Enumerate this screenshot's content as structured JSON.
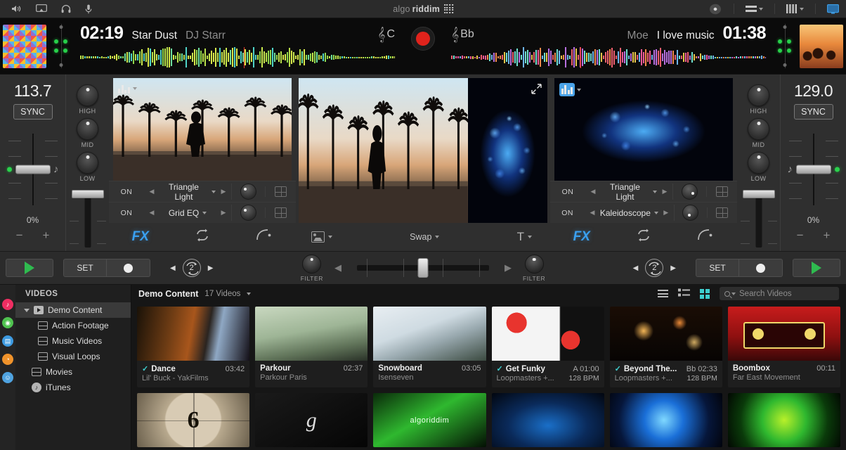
{
  "menubar": {
    "icons": [
      "speaker-icon",
      "airplay-icon",
      "headphones-icon",
      "microphone-icon"
    ],
    "brand_light": "algo",
    "brand_bold": "riddim",
    "right_icons": [
      "record-toggle-icon",
      "list-view-icon",
      "waveform-view-icon",
      "display-icon"
    ]
  },
  "deckA": {
    "time": "02:19",
    "title": "Star Dust",
    "artist": "DJ Starr",
    "key": "C",
    "bpm": "113.7",
    "sync_label": "SYNC",
    "pitch_percent": "0%",
    "eq": [
      {
        "label": "HIGH"
      },
      {
        "label": "MID"
      },
      {
        "label": "LOW"
      }
    ],
    "fx": [
      {
        "on": "ON",
        "name": "Triangle Light"
      },
      {
        "on": "ON",
        "name": "Grid EQ"
      }
    ],
    "tools": {
      "fx": "FX",
      "loop": "loop-icon",
      "bounce": "bounce-icon"
    },
    "transport": {
      "play": "play-icon",
      "set": "SET",
      "cue": "cue-icon",
      "loop_beats": "2"
    },
    "filter_label": "FILTER"
  },
  "deckB": {
    "time": "01:38",
    "title": "I love music",
    "artist": "Moe",
    "key": "Bb",
    "bpm": "129.0",
    "sync_label": "SYNC",
    "pitch_percent": "0%",
    "eq": [
      {
        "label": "HIGH"
      },
      {
        "label": "MID"
      },
      {
        "label": "LOW"
      }
    ],
    "fx": [
      {
        "on": "ON",
        "name": "Triangle Light"
      },
      {
        "on": "ON",
        "name": "Kaleidoscope"
      }
    ],
    "tools": {
      "fx": "FX",
      "loop": "loop-icon",
      "bounce": "bounce-icon"
    },
    "transport": {
      "play": "play-icon",
      "set": "SET",
      "cue": "cue-icon",
      "loop_beats": "2"
    },
    "filter_label": "FILTER"
  },
  "center": {
    "video_source_label": "video-source-icon",
    "swap_label": "Swap",
    "text_label": "text-icon"
  },
  "browser": {
    "sidebar_header": "VIDEOS",
    "items": [
      {
        "label": "Demo Content",
        "icon": "playlist-icon",
        "selected": true,
        "indent": 0,
        "disclosure": true
      },
      {
        "label": "Action Footage",
        "icon": "folder-icon",
        "selected": false,
        "indent": 1,
        "disclosure": false
      },
      {
        "label": "Music Videos",
        "icon": "folder-icon",
        "selected": false,
        "indent": 1,
        "disclosure": false
      },
      {
        "label": "Visual Loops",
        "icon": "folder-icon",
        "selected": false,
        "indent": 1,
        "disclosure": false
      },
      {
        "label": "Movies",
        "icon": "folder-icon",
        "selected": false,
        "indent": 0,
        "disclosure": false
      },
      {
        "label": "iTunes",
        "icon": "music-note-icon",
        "selected": false,
        "indent": 0,
        "disclosure": false
      }
    ],
    "breadcrumb": "Demo Content",
    "count": "17 Videos",
    "view_buttons": [
      "list-view-icon",
      "detail-view-icon",
      "grid-view-icon"
    ],
    "search_placeholder": "Search Videos",
    "grid_items": [
      {
        "title": "Dance",
        "artist": "Lil' Buck - YakFilms",
        "duration": "03:42",
        "key": "",
        "bpm": "",
        "checked": true,
        "thumb": "graffiti-wall"
      },
      {
        "title": "Parkour",
        "artist": "Parkour Paris",
        "duration": "02:37",
        "key": "",
        "bpm": "",
        "checked": false,
        "thumb": "green-hoodie"
      },
      {
        "title": "Snowboard",
        "artist": "Isenseven",
        "duration": "03:05",
        "key": "",
        "bpm": "",
        "checked": false,
        "thumb": "snow-slope"
      },
      {
        "title": "Get Funky",
        "artist": "Loopmasters +...",
        "duration": "01:00",
        "key": "A",
        "bpm": "128 BPM",
        "checked": true,
        "thumb": "red-shapes"
      },
      {
        "title": "Beyond The...",
        "artist": "Loopmasters +...",
        "duration": "02:33",
        "key": "Bb",
        "bpm": "128 BPM",
        "checked": true,
        "thumb": "orange-bokeh"
      },
      {
        "title": "Boombox",
        "artist": "Far East Movement",
        "duration": "00:11",
        "key": "",
        "bpm": "",
        "checked": false,
        "thumb": "red-boombox"
      },
      {
        "title": "",
        "artist": "",
        "duration": "",
        "key": "",
        "bpm": "",
        "checked": false,
        "thumb": "countdown-6"
      },
      {
        "title": "",
        "artist": "",
        "duration": "",
        "key": "",
        "bpm": "",
        "checked": false,
        "thumb": "g-logo"
      },
      {
        "title": "",
        "artist": "",
        "duration": "",
        "key": "",
        "bpm": "",
        "checked": false,
        "thumb": "green-algoriddim"
      },
      {
        "title": "",
        "artist": "",
        "duration": "",
        "key": "",
        "bpm": "",
        "checked": false,
        "thumb": "blue-swirl"
      },
      {
        "title": "",
        "artist": "",
        "duration": "",
        "key": "",
        "bpm": "",
        "checked": false,
        "thumb": "blue-vortex"
      },
      {
        "title": "",
        "artist": "",
        "duration": "",
        "key": "",
        "bpm": "",
        "checked": false,
        "thumb": "green-burst"
      }
    ]
  },
  "dock": [
    {
      "name": "itunes-icon",
      "color": "#ef2e62"
    },
    {
      "name": "spotify-icon",
      "color": "#4fc24f"
    },
    {
      "name": "video-library-icon",
      "color": "#3d9ae0"
    },
    {
      "name": "history-icon",
      "color": "#f0932b"
    },
    {
      "name": "finder-icon",
      "color": "#4fa3e0"
    }
  ],
  "colors": {
    "accent_blue": "#3aa0f0",
    "accent_teal": "#3ecfcf",
    "play_green": "#2fbb4f",
    "record_red": "#e0231c"
  }
}
